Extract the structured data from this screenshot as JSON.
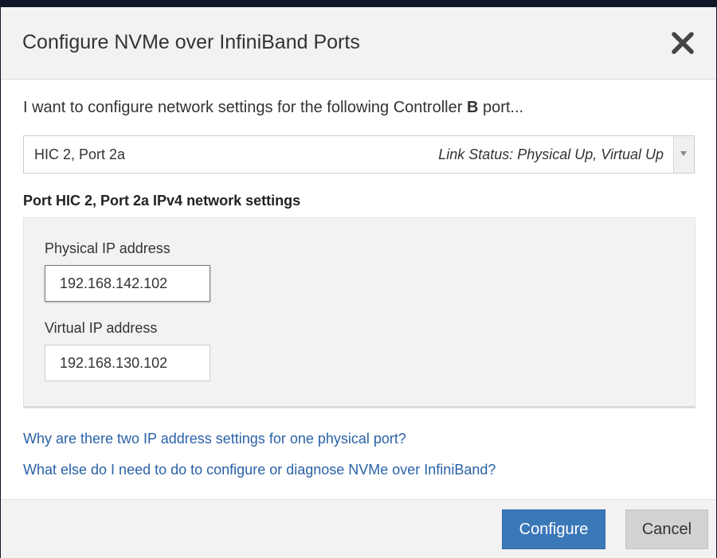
{
  "dialog": {
    "title": "Configure NVMe over InfiniBand Ports",
    "close_icon": "close-icon"
  },
  "intro": {
    "prefix": "I want to configure network settings for the following Controller ",
    "controller": "B",
    "suffix": " port..."
  },
  "port_select": {
    "selected_value": "HIC 2, Port 2a",
    "link_status": "Link Status: Physical Up, Virtual Up",
    "arrow_icon": "caret-down-icon"
  },
  "settings": {
    "heading": "Port HIC 2, Port 2a IPv4 network settings",
    "physical_label": "Physical IP address",
    "physical_value": "192.168.142.102",
    "virtual_label": "Virtual IP address",
    "virtual_value": "192.168.130.102"
  },
  "links": {
    "why_two": "Why are there two IP address settings for one physical port?",
    "what_else": "What else do I need to do to configure or diagnose NVMe over InfiniBand?"
  },
  "footer": {
    "configure_label": "Configure",
    "cancel_label": "Cancel"
  },
  "colors": {
    "primary": "#3b78b8",
    "link": "#2a62a7",
    "panel": "#f2f2f2"
  }
}
